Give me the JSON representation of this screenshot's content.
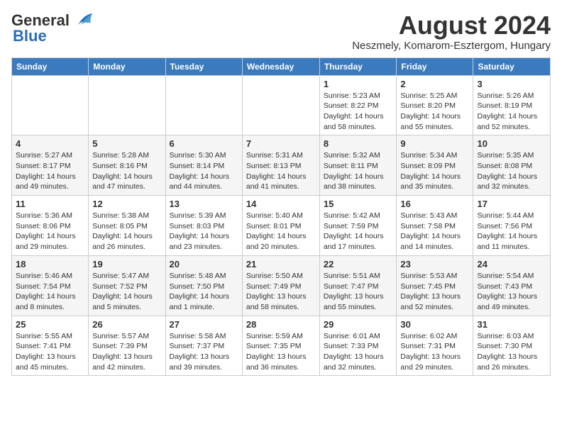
{
  "logo": {
    "line1": "General",
    "line2": "Blue"
  },
  "title": "August 2024",
  "subtitle": "Neszmely, Komarom-Esztergom, Hungary",
  "days_header": [
    "Sunday",
    "Monday",
    "Tuesday",
    "Wednesday",
    "Thursday",
    "Friday",
    "Saturday"
  ],
  "weeks": [
    [
      {
        "day": "",
        "info": ""
      },
      {
        "day": "",
        "info": ""
      },
      {
        "day": "",
        "info": ""
      },
      {
        "day": "",
        "info": ""
      },
      {
        "day": "1",
        "info": "Sunrise: 5:23 AM\nSunset: 8:22 PM\nDaylight: 14 hours\nand 58 minutes."
      },
      {
        "day": "2",
        "info": "Sunrise: 5:25 AM\nSunset: 8:20 PM\nDaylight: 14 hours\nand 55 minutes."
      },
      {
        "day": "3",
        "info": "Sunrise: 5:26 AM\nSunset: 8:19 PM\nDaylight: 14 hours\nand 52 minutes."
      }
    ],
    [
      {
        "day": "4",
        "info": "Sunrise: 5:27 AM\nSunset: 8:17 PM\nDaylight: 14 hours\nand 49 minutes."
      },
      {
        "day": "5",
        "info": "Sunrise: 5:28 AM\nSunset: 8:16 PM\nDaylight: 14 hours\nand 47 minutes."
      },
      {
        "day": "6",
        "info": "Sunrise: 5:30 AM\nSunset: 8:14 PM\nDaylight: 14 hours\nand 44 minutes."
      },
      {
        "day": "7",
        "info": "Sunrise: 5:31 AM\nSunset: 8:13 PM\nDaylight: 14 hours\nand 41 minutes."
      },
      {
        "day": "8",
        "info": "Sunrise: 5:32 AM\nSunset: 8:11 PM\nDaylight: 14 hours\nand 38 minutes."
      },
      {
        "day": "9",
        "info": "Sunrise: 5:34 AM\nSunset: 8:09 PM\nDaylight: 14 hours\nand 35 minutes."
      },
      {
        "day": "10",
        "info": "Sunrise: 5:35 AM\nSunset: 8:08 PM\nDaylight: 14 hours\nand 32 minutes."
      }
    ],
    [
      {
        "day": "11",
        "info": "Sunrise: 5:36 AM\nSunset: 8:06 PM\nDaylight: 14 hours\nand 29 minutes."
      },
      {
        "day": "12",
        "info": "Sunrise: 5:38 AM\nSunset: 8:05 PM\nDaylight: 14 hours\nand 26 minutes."
      },
      {
        "day": "13",
        "info": "Sunrise: 5:39 AM\nSunset: 8:03 PM\nDaylight: 14 hours\nand 23 minutes."
      },
      {
        "day": "14",
        "info": "Sunrise: 5:40 AM\nSunset: 8:01 PM\nDaylight: 14 hours\nand 20 minutes."
      },
      {
        "day": "15",
        "info": "Sunrise: 5:42 AM\nSunset: 7:59 PM\nDaylight: 14 hours\nand 17 minutes."
      },
      {
        "day": "16",
        "info": "Sunrise: 5:43 AM\nSunset: 7:58 PM\nDaylight: 14 hours\nand 14 minutes."
      },
      {
        "day": "17",
        "info": "Sunrise: 5:44 AM\nSunset: 7:56 PM\nDaylight: 14 hours\nand 11 minutes."
      }
    ],
    [
      {
        "day": "18",
        "info": "Sunrise: 5:46 AM\nSunset: 7:54 PM\nDaylight: 14 hours\nand 8 minutes."
      },
      {
        "day": "19",
        "info": "Sunrise: 5:47 AM\nSunset: 7:52 PM\nDaylight: 14 hours\nand 5 minutes."
      },
      {
        "day": "20",
        "info": "Sunrise: 5:48 AM\nSunset: 7:50 PM\nDaylight: 14 hours\nand 1 minute."
      },
      {
        "day": "21",
        "info": "Sunrise: 5:50 AM\nSunset: 7:49 PM\nDaylight: 13 hours\nand 58 minutes."
      },
      {
        "day": "22",
        "info": "Sunrise: 5:51 AM\nSunset: 7:47 PM\nDaylight: 13 hours\nand 55 minutes."
      },
      {
        "day": "23",
        "info": "Sunrise: 5:53 AM\nSunset: 7:45 PM\nDaylight: 13 hours\nand 52 minutes."
      },
      {
        "day": "24",
        "info": "Sunrise: 5:54 AM\nSunset: 7:43 PM\nDaylight: 13 hours\nand 49 minutes."
      }
    ],
    [
      {
        "day": "25",
        "info": "Sunrise: 5:55 AM\nSunset: 7:41 PM\nDaylight: 13 hours\nand 45 minutes."
      },
      {
        "day": "26",
        "info": "Sunrise: 5:57 AM\nSunset: 7:39 PM\nDaylight: 13 hours\nand 42 minutes."
      },
      {
        "day": "27",
        "info": "Sunrise: 5:58 AM\nSunset: 7:37 PM\nDaylight: 13 hours\nand 39 minutes."
      },
      {
        "day": "28",
        "info": "Sunrise: 5:59 AM\nSunset: 7:35 PM\nDaylight: 13 hours\nand 36 minutes."
      },
      {
        "day": "29",
        "info": "Sunrise: 6:01 AM\nSunset: 7:33 PM\nDaylight: 13 hours\nand 32 minutes."
      },
      {
        "day": "30",
        "info": "Sunrise: 6:02 AM\nSunset: 7:31 PM\nDaylight: 13 hours\nand 29 minutes."
      },
      {
        "day": "31",
        "info": "Sunrise: 6:03 AM\nSunset: 7:30 PM\nDaylight: 13 hours\nand 26 minutes."
      }
    ]
  ]
}
